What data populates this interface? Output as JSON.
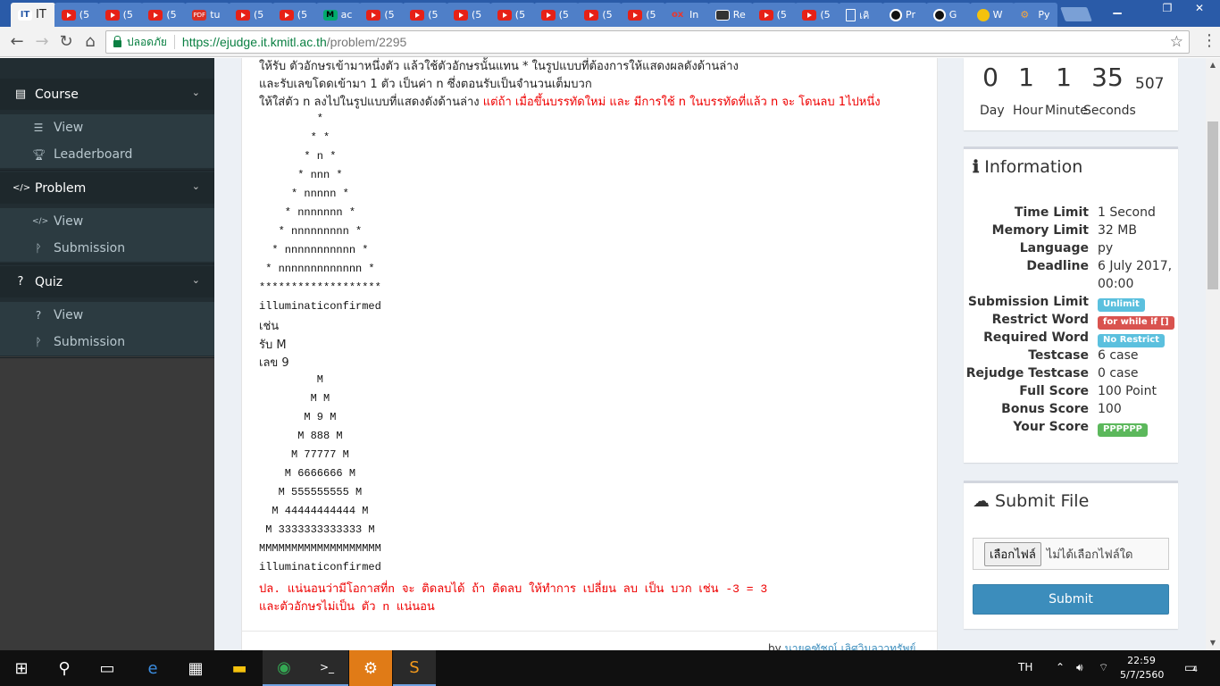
{
  "browser": {
    "tabs": [
      {
        "icon": "itk",
        "label": "IT"
      },
      {
        "icon": "youtube",
        "label": "(5"
      },
      {
        "icon": "youtube",
        "label": "(5"
      },
      {
        "icon": "youtube",
        "label": "(5"
      },
      {
        "icon": "pdf",
        "label": "tu"
      },
      {
        "icon": "youtube",
        "label": "(5"
      },
      {
        "icon": "youtube",
        "label": "(5"
      },
      {
        "icon": "medium",
        "label": "ac"
      },
      {
        "icon": "youtube",
        "label": "(5"
      },
      {
        "icon": "youtube",
        "label": "(5"
      },
      {
        "icon": "youtube",
        "label": "(5"
      },
      {
        "icon": "youtube",
        "label": "(5"
      },
      {
        "icon": "youtube",
        "label": "(5"
      },
      {
        "icon": "youtube",
        "label": "(5"
      },
      {
        "icon": "youtube",
        "label": "(5"
      },
      {
        "icon": "ox",
        "label": "In"
      },
      {
        "icon": "reader",
        "label": "Re"
      },
      {
        "icon": "youtube",
        "label": "(5"
      },
      {
        "icon": "youtube",
        "label": "(5"
      },
      {
        "icon": "doc",
        "label": "เคิ"
      },
      {
        "icon": "github",
        "label": "Pr"
      },
      {
        "icon": "github",
        "label": "G"
      },
      {
        "icon": "yellow",
        "label": "W"
      },
      {
        "icon": "python",
        "label": "Py"
      }
    ],
    "security_label": "ปลอดภัย",
    "url_host": "https://ejudge.it.kmitl.ac.th",
    "url_path": "/problem/2295"
  },
  "sidebar": {
    "sections": [
      {
        "label": "Course",
        "icon": "dashboard-icon",
        "items": [
          {
            "label": "View",
            "icon": "list-icon"
          },
          {
            "label": "Leaderboard",
            "icon": "trophy-icon"
          }
        ]
      },
      {
        "label": "Problem",
        "icon": "code-icon",
        "items": [
          {
            "label": "View",
            "icon": "code-icon"
          },
          {
            "label": "Submission",
            "icon": "branch-icon"
          }
        ]
      },
      {
        "label": "Quiz",
        "icon": "question-icon",
        "items": [
          {
            "label": "View",
            "icon": "question-icon"
          },
          {
            "label": "Submission",
            "icon": "branch-icon"
          }
        ]
      }
    ]
  },
  "problem": {
    "desc_line1": "ให้รับ ตัวอักษรเข้ามาหนึ่งตัว แล้วใช้ตัวอักษรนั้นแทน * ในรูปแบบที่ต้องการให้แสดงผลดังด้านล่าง",
    "desc_line2": "และรับเลขโดดเข้ามา 1 ตัว เป็นค่า n ซึ่งตอนรับเป็นจำนวนเต็มบวก",
    "desc_line3_black": "ให้ใส่ตัว n ลงไปในรูปแบบที่แสดงดังด้านล่าง ",
    "desc_line3_red": "แต่ถ้า เมื่อขึ้นบรรทัดใหม่ และ มีการใช้ n ในบรรทัดที่แล้ว n จะ โดนลบ 1ไปหนึ่ง",
    "pattern_lines": [
      "         *",
      "        * *",
      "       * n *",
      "      * nnn *",
      "     * nnnnn *",
      "    * nnnnnnn *",
      "   * nnnnnnnnn *",
      "  * nnnnnnnnnnn *",
      " * nnnnnnnnnnnnn *",
      "*******************",
      "illuminaticonfirmed"
    ],
    "example_label": "เช่น",
    "example_input_char": "รับ M",
    "example_input_num": "เลข 9",
    "example_lines": [
      "         M",
      "        M M",
      "       M 9 M",
      "      M 888 M",
      "     M 77777 M",
      "    M 6666666 M",
      "   M 555555555 M",
      "  M 44444444444 M",
      " M 3333333333333 M",
      "MMMMMMMMMMMMMMMMMMM",
      "illuminaticonfirmed"
    ],
    "note1": "ปล. แน่นอนว่ามีโอกาสที่n จะ ติดลบได้ ถ้า ติดลบ ให้ทำการ เปลี่ยน ลบ เป็น บวก เช่น -3 = 3",
    "note2": "และตัวอักษรไม่เป็น ตัว n แน่นอน",
    "byline_prefix": "by",
    "author": "นายคฑัชณ์ เลิศวิมลวาทรัพย์"
  },
  "countdown": {
    "day": "0",
    "hour": "1",
    "minute": "1",
    "seconds": "35",
    "ms": "507",
    "day_label": "Day",
    "hour_label": "Hour",
    "minute_label": "Minute",
    "seconds_label": "Seconds"
  },
  "info": {
    "title": "Information",
    "rows": [
      {
        "key": "Time Limit",
        "value": "1 Second"
      },
      {
        "key": "Memory Limit",
        "value": "32 MB"
      },
      {
        "key": "Language",
        "value": "py"
      },
      {
        "key": "Deadline",
        "value": "6 July 2017,",
        "value2": "00:00"
      },
      {
        "key": "Submission Limit",
        "badge": "Unlimit",
        "badge_color": "#5bc0de"
      },
      {
        "key": "Restrict Word",
        "badge": "for while if []",
        "badge_color": "#d9534f"
      },
      {
        "key": "Required Word",
        "badge": "No Restrict",
        "badge_color": "#5bc0de"
      },
      {
        "key": "Testcase",
        "value": "6 case"
      },
      {
        "key": "Rejudge Testcase",
        "value": "0 case"
      },
      {
        "key": "Full Score",
        "value": "100 Point"
      },
      {
        "key": "Bonus Score",
        "value": "100"
      },
      {
        "key": "Your Score",
        "badge": "PPPPPP",
        "badge_color": "#5cb85c"
      }
    ]
  },
  "submit": {
    "title": "Submit File",
    "choose_label": "เลือกไฟล์",
    "no_file_label": "ไม่ได้เลือกไฟล์ใด",
    "button_label": "Submit"
  },
  "taskbar": {
    "lang": "TH",
    "time": "22:59",
    "date": "5/7/2560",
    "notifications": "4"
  }
}
